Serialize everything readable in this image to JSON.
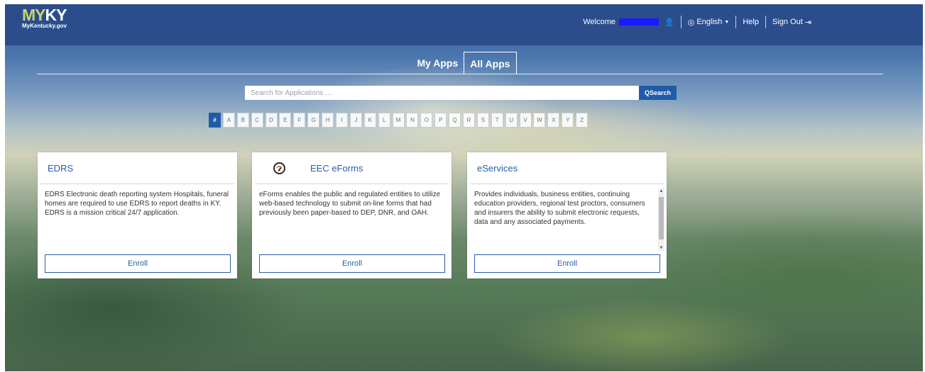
{
  "header": {
    "logo": {
      "my": "MY",
      "ky": "KY",
      "domain": "MyKentucky.gov"
    },
    "welcome": "Welcome",
    "language": "English",
    "help": "Help",
    "sign_out": "Sign Out"
  },
  "tabs": [
    {
      "label": "My Apps",
      "active": false
    },
    {
      "label": "All Apps",
      "active": true
    }
  ],
  "search": {
    "placeholder": "Search for Applications ....",
    "button_label": "Search"
  },
  "alphabet": [
    "#",
    "A",
    "B",
    "C",
    "D",
    "E",
    "F",
    "G",
    "H",
    "I",
    "J",
    "K",
    "L",
    "M",
    "N",
    "O",
    "P",
    "Q",
    "R",
    "S",
    "T",
    "U",
    "V",
    "W",
    "X",
    "Y",
    "Z"
  ],
  "alphabet_selected": "#",
  "apps": [
    {
      "title": "EDRS",
      "description": "EDRS Electronic death reporting system Hospitals, funeral homes are required to use EDRS to report deaths in KY. EDRS is a mission critical 24/7 application.",
      "enroll_label": "Enroll"
    },
    {
      "title": "EEC eForms",
      "icon": "gauge-icon",
      "description": "eForms enables the public and regulated entities to utilize web-based technology to submit on-line forms that had previously been paper-based to DEP, DNR, and OAH.",
      "enroll_label": "Enroll"
    },
    {
      "title": "eServices",
      "description": "Provides individuals, business entities, continuing education providers, regional test proctors, consumers and insurers the ability to submit electronic requests, data and any associated payments.",
      "enroll_label": "Enroll"
    }
  ],
  "colors": {
    "header_bg": "#2b4d8c",
    "accent": "#1f5ca8",
    "card_title": "#2a5ea6",
    "logo_my": "#c9d46e"
  }
}
